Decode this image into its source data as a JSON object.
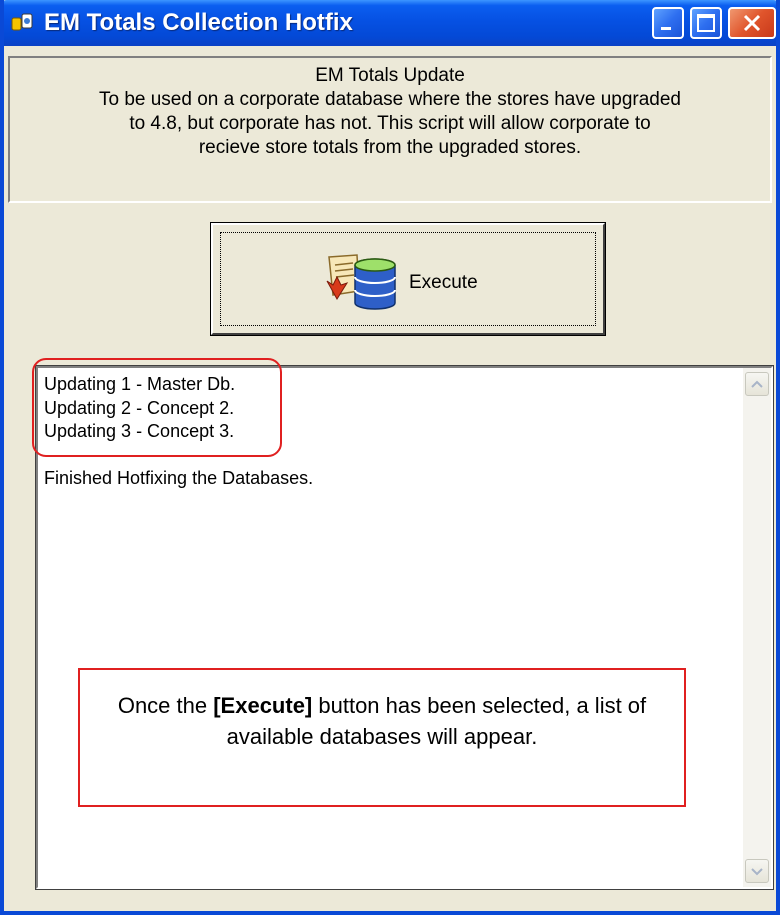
{
  "window": {
    "title": "EM Totals Collection Hotfix"
  },
  "info": {
    "heading": "EM Totals Update",
    "lines": [
      "To be used on a corporate database where the stores have upgraded",
      "to 4.8, but corporate has not.  This script will allow corporate to",
      "recieve store totals from the upgraded stores."
    ]
  },
  "execute_button": {
    "label": "Execute",
    "icon": "database-script-icon"
  },
  "log": {
    "lines": [
      "Updating 1 - Master Db.",
      "Updating 2 - Concept 2.",
      "Updating 3 - Concept 3.",
      "",
      "Finished Hotfixing the Databases."
    ]
  },
  "callout": {
    "before": "Once the ",
    "bold": "[Execute]",
    "after": " button has been selected, a list of available databases will appear."
  },
  "colors": {
    "titlebar": "#0449d6",
    "window_bg": "#ece9d8",
    "annotation": "#e02020"
  }
}
